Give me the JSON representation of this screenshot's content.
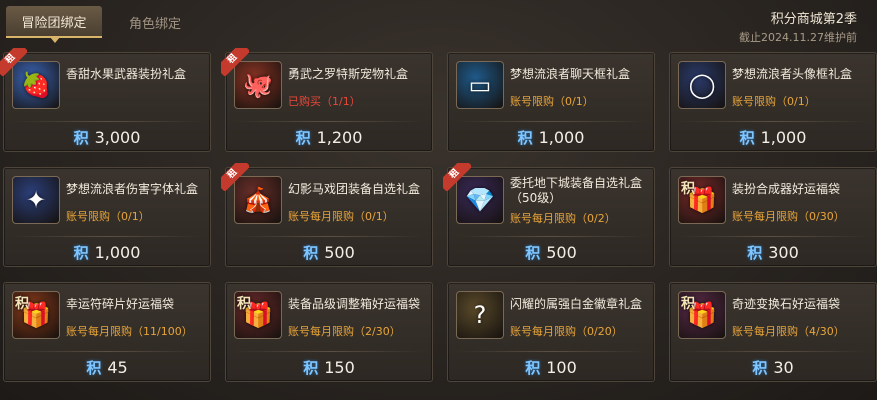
{
  "tabs": [
    {
      "label": "冒险团绑定",
      "active": true
    },
    {
      "label": "角色绑定",
      "active": false
    }
  ],
  "season": {
    "title": "积分商城第2季",
    "subtitle": "截止2024.11.27维护前"
  },
  "currency_label": "积",
  "badge_label": "租",
  "colors": {
    "price_symbol": "#7fc6ff",
    "limit": "#e8a53a",
    "bought": "#e8493a"
  },
  "items": [
    {
      "name": "香甜水果武器装扮礼盒",
      "limit": "",
      "price": "3,000",
      "badge": true,
      "icon": "fruit-box-icon",
      "icon_color": "#3b66b8",
      "glyph": "🍓",
      "icon_ji": false
    },
    {
      "name": "勇武之罗特斯宠物礼盒",
      "limit": "已购买（1/1）",
      "bought": true,
      "price": "1,200",
      "badge": true,
      "icon": "pet-box-icon",
      "icon_color": "#8a3424",
      "glyph": "🐙",
      "icon_ji": false
    },
    {
      "name": "梦想流浪者聊天框礼盒",
      "limit": "账号限购（0/1）",
      "price": "1,000",
      "badge": false,
      "icon": "chat-frame-icon",
      "icon_color": "#1f5a8a",
      "glyph": "▭",
      "icon_ji": false
    },
    {
      "name": "梦想流浪者头像框礼盒",
      "limit": "账号限购（0/1）",
      "price": "1,000",
      "badge": false,
      "icon": "avatar-frame-icon",
      "icon_color": "#2a3a6a",
      "glyph": "◯",
      "icon_ji": false
    },
    {
      "name": "梦想流浪者伤害字体礼盒",
      "limit": "账号限购（0/1）",
      "price": "1,000",
      "badge": false,
      "icon": "damage-font-icon",
      "icon_color": "#2b3f7a",
      "glyph": "✦",
      "icon_ji": false
    },
    {
      "name": "幻影马戏团装备自选礼盒",
      "limit": "账号每月限购（0/1）",
      "price": "500",
      "badge": true,
      "icon": "circus-box-icon",
      "icon_color": "#6a2f2a",
      "glyph": "🎪",
      "icon_ji": false
    },
    {
      "name": "委托地下城装备自选礼盒（50级）",
      "limit": "账号每月限购（0/2）",
      "price": "500",
      "badge": true,
      "icon": "dungeon-box-icon",
      "icon_color": "#3a2a5a",
      "glyph": "💎",
      "icon_ji": false
    },
    {
      "name": "装扮合成器好运福袋",
      "limit": "账号每月限购（0/30）",
      "price": "300",
      "badge": false,
      "icon": "synth-bag-icon",
      "icon_color": "#7a2a2a",
      "glyph": "🎁",
      "icon_ji": true
    },
    {
      "name": "幸运符碎片好运福袋",
      "limit": "账号每月限购（11/100）",
      "price": "45",
      "badge": false,
      "icon": "charm-bag-icon",
      "icon_color": "#8a3a1a",
      "glyph": "🎁",
      "icon_ji": true
    },
    {
      "name": "装备品级调整箱好运福袋",
      "limit": "账号每月限购（2/30）",
      "price": "150",
      "badge": false,
      "icon": "grade-box-icon",
      "icon_color": "#6a2a2a",
      "glyph": "🎁",
      "icon_ji": true
    },
    {
      "name": "闪耀的属强白金徽章礼盒",
      "limit": "账号每月限购（0/20）",
      "price": "100",
      "badge": false,
      "icon": "platinum-badge-icon",
      "icon_color": "#5a4a2a",
      "glyph": "?",
      "icon_ji": false
    },
    {
      "name": "奇迹变换石好运福袋",
      "limit": "账号每月限购（4/30）",
      "price": "30",
      "badge": false,
      "icon": "miracle-stone-icon",
      "icon_color": "#5a2a4a",
      "glyph": "🎁",
      "icon_ji": true
    }
  ]
}
